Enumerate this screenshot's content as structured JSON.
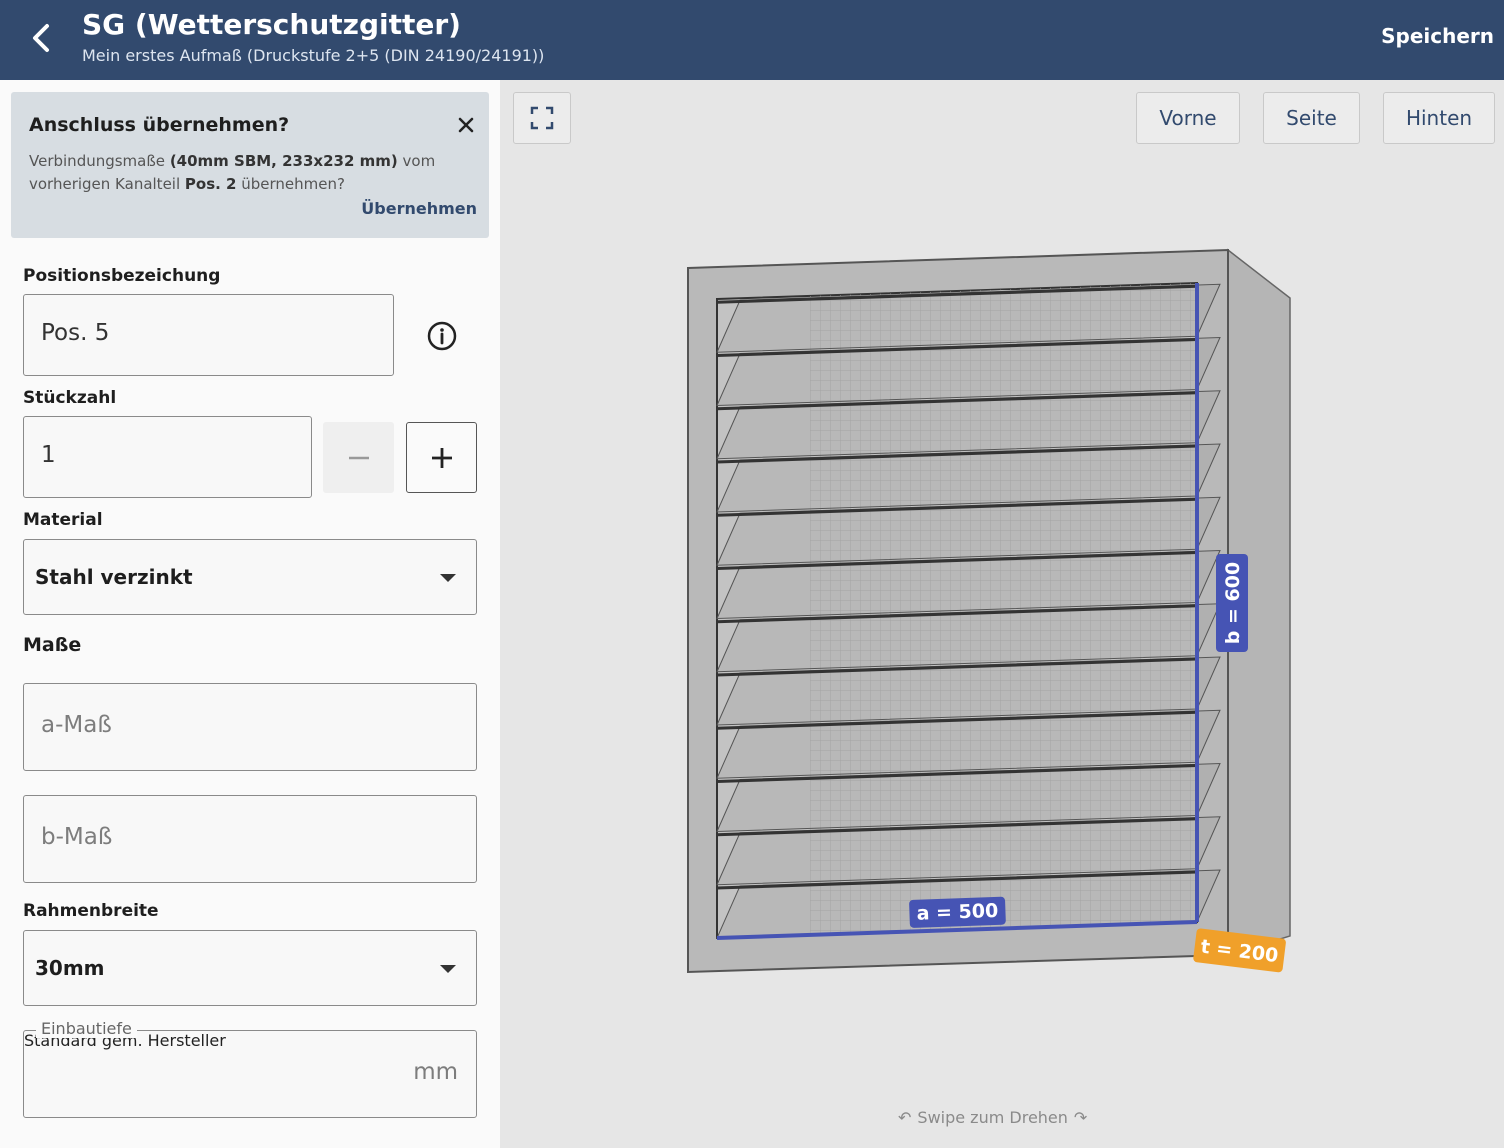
{
  "header": {
    "title": "SG (Wetterschutzgitter)",
    "subtitle": "Mein erstes Aufmaß (Druckstufe 2+5 (DIN 24190/24191))",
    "save_label": "Speichern"
  },
  "notice": {
    "title": "Anschluss übernehmen?",
    "text_1": "Verbindungsmaße ",
    "text_bold_1": "(40mm SBM, 233x232 mm)",
    "text_2": " vom vorherigen Kanalteil ",
    "text_bold_2": "Pos. 2",
    "text_3": " übernehmen?",
    "action_label": "Übernehmen"
  },
  "form": {
    "position_label": "Positionsbezeichung",
    "position_value": "Pos. 5",
    "count_label": "Stückzahl",
    "count_value": "1",
    "material_label": "Material",
    "material_value": "Stahl verzinkt",
    "dimensions_label": "Maße",
    "a_placeholder": "a-Maß",
    "b_placeholder": "b-Maß",
    "frame_label": "Rahmenbreite",
    "frame_value": "30mm",
    "depth_label": "Einbautiefe",
    "depth_placeholder": "Standard gem. Hersteller",
    "depth_unit": "mm"
  },
  "viewer": {
    "views": [
      "Vorne",
      "Seite",
      "Hinten"
    ],
    "dim_a": "a = 500",
    "dim_b": "b = 600",
    "dim_t": "t = 200",
    "hint": "Swipe zum Drehen"
  },
  "colors": {
    "header": "#324a6e",
    "dim_a_b": "#4654b4",
    "dim_t": "#f0a02a"
  }
}
